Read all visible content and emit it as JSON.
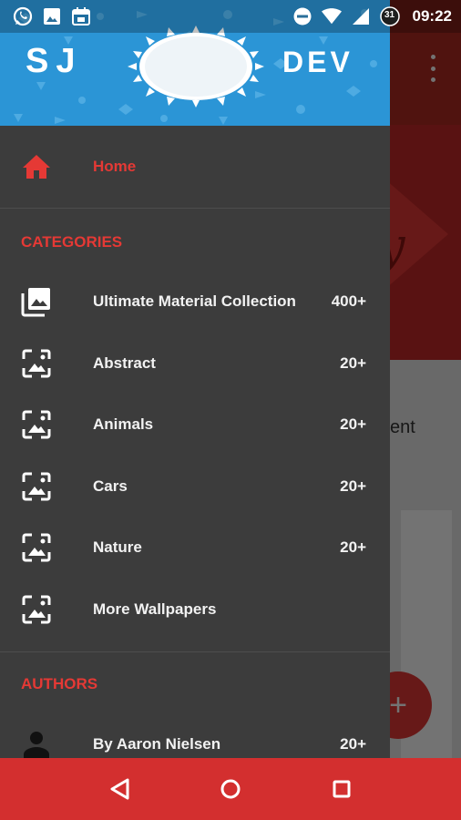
{
  "status_bar": {
    "time": "09:22",
    "notification_badge": "31",
    "icons": [
      "whatsapp-icon",
      "gallery-icon",
      "calendar-icon",
      "do-not-disturb-icon",
      "wifi-icon",
      "signal-icon",
      "battery-icon"
    ]
  },
  "app": {
    "body_text_fragment": "ent",
    "decor_letter": "y",
    "fab_label": "+",
    "accent_color": "#e53935",
    "navbar_color": "#d32f2f"
  },
  "drawer": {
    "header": {
      "logo_left": "SJ",
      "logo_right": "DEV",
      "background_color": "#2b95d6"
    },
    "home": {
      "label": "Home",
      "icon": "home-icon"
    },
    "categories_title": "CATEGORIES",
    "categories": [
      {
        "label": "Ultimate Material Collection",
        "count": "400+",
        "icon": "photo-library-icon"
      },
      {
        "label": "Abstract",
        "count": "20+",
        "icon": "wallpaper-icon"
      },
      {
        "label": "Animals",
        "count": "20+",
        "icon": "wallpaper-icon"
      },
      {
        "label": "Cars",
        "count": "20+",
        "icon": "wallpaper-icon"
      },
      {
        "label": "Nature",
        "count": "20+",
        "icon": "wallpaper-icon"
      },
      {
        "label": "More Wallpapers",
        "count": "",
        "icon": "wallpaper-icon"
      }
    ],
    "authors_title": "AUTHORS",
    "authors": [
      {
        "label": "By Aaron Nielsen",
        "count": "20+",
        "icon": "person-icon"
      }
    ]
  },
  "nav_bar": {
    "buttons": [
      "back-icon",
      "home-circle-icon",
      "recents-icon"
    ]
  }
}
